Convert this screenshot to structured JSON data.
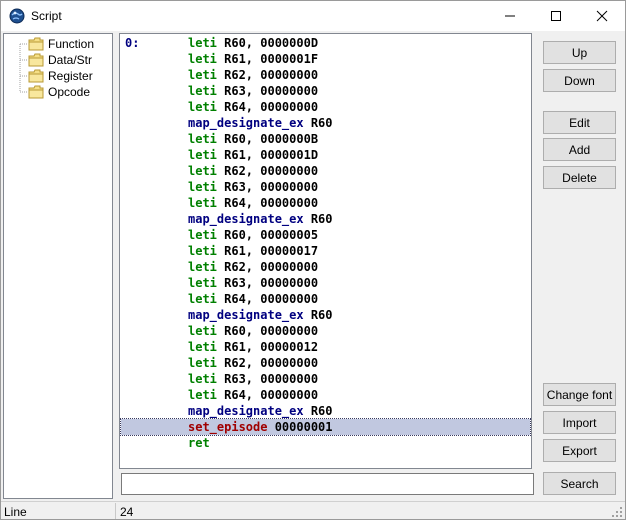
{
  "window": {
    "title": "Script",
    "icon": "app-globe-icon"
  },
  "tree": {
    "items": [
      {
        "label": "Function",
        "icon": "folder-icon"
      },
      {
        "label": "Data/Str",
        "icon": "folder-icon"
      },
      {
        "label": "Register",
        "icon": "folder-icon"
      },
      {
        "label": "Opcode",
        "icon": "folder-icon"
      }
    ]
  },
  "code": {
    "lines": [
      {
        "num": "0:",
        "op": "leti",
        "args": " R60, 0000000D",
        "kind": "leti"
      },
      {
        "num": "",
        "op": "leti",
        "args": " R61, 0000001F",
        "kind": "leti"
      },
      {
        "num": "",
        "op": "leti",
        "args": " R62, 00000000",
        "kind": "leti"
      },
      {
        "num": "",
        "op": "leti",
        "args": " R63, 00000000",
        "kind": "leti"
      },
      {
        "num": "",
        "op": "leti",
        "args": " R64, 00000000",
        "kind": "leti"
      },
      {
        "num": "",
        "op": "map_designate_ex",
        "args": " R60",
        "kind": "map"
      },
      {
        "num": "",
        "op": "leti",
        "args": " R60, 0000000B",
        "kind": "leti"
      },
      {
        "num": "",
        "op": "leti",
        "args": " R61, 0000001D",
        "kind": "leti"
      },
      {
        "num": "",
        "op": "leti",
        "args": " R62, 00000000",
        "kind": "leti"
      },
      {
        "num": "",
        "op": "leti",
        "args": " R63, 00000000",
        "kind": "leti"
      },
      {
        "num": "",
        "op": "leti",
        "args": " R64, 00000000",
        "kind": "leti"
      },
      {
        "num": "",
        "op": "map_designate_ex",
        "args": " R60",
        "kind": "map"
      },
      {
        "num": "",
        "op": "leti",
        "args": " R60, 00000005",
        "kind": "leti"
      },
      {
        "num": "",
        "op": "leti",
        "args": " R61, 00000017",
        "kind": "leti"
      },
      {
        "num": "",
        "op": "leti",
        "args": " R62, 00000000",
        "kind": "leti"
      },
      {
        "num": "",
        "op": "leti",
        "args": " R63, 00000000",
        "kind": "leti"
      },
      {
        "num": "",
        "op": "leti",
        "args": " R64, 00000000",
        "kind": "leti"
      },
      {
        "num": "",
        "op": "map_designate_ex",
        "args": " R60",
        "kind": "map"
      },
      {
        "num": "",
        "op": "leti",
        "args": " R60, 00000000",
        "kind": "leti"
      },
      {
        "num": "",
        "op": "leti",
        "args": " R61, 00000012",
        "kind": "leti"
      },
      {
        "num": "",
        "op": "leti",
        "args": " R62, 00000000",
        "kind": "leti"
      },
      {
        "num": "",
        "op": "leti",
        "args": " R63, 00000000",
        "kind": "leti"
      },
      {
        "num": "",
        "op": "leti",
        "args": " R64, 00000000",
        "kind": "leti"
      },
      {
        "num": "",
        "op": "map_designate_ex",
        "args": " R60",
        "kind": "map"
      },
      {
        "num": "",
        "op": "set_episode",
        "args": " 00000001",
        "kind": "set",
        "selected": true
      },
      {
        "num": "",
        "op": "ret",
        "args": "",
        "kind": "ret"
      }
    ]
  },
  "buttons": {
    "up": "Up",
    "down": "Down",
    "edit": "Edit",
    "add": "Add",
    "delete": "Delete",
    "change_font": "Change font",
    "import": "Import",
    "export": "Export",
    "search": "Search"
  },
  "search": {
    "value": ""
  },
  "status": {
    "label": "Line",
    "value": "24"
  },
  "colors": {
    "opcode_leti": "#008000",
    "opcode_map": "#000080",
    "opcode_set": "#a00000",
    "selection": "#c1c8e0"
  }
}
